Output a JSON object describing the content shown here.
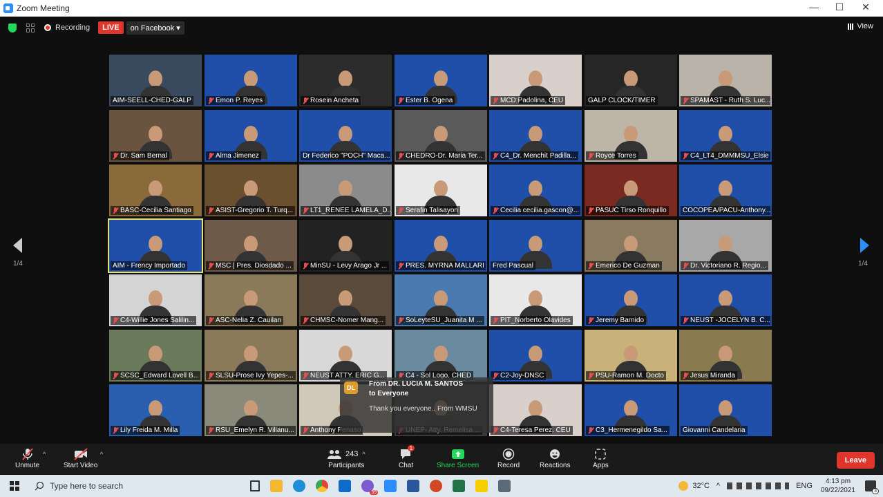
{
  "window": {
    "title": "Zoom Meeting",
    "minimize": "—",
    "maximize": "☐",
    "close": "✕"
  },
  "topbar": {
    "recording": "Recording",
    "live": "LIVE",
    "live_target": "on Facebook ▾",
    "view": "View"
  },
  "pagination": {
    "left": "1/4",
    "right": "1/4"
  },
  "participants": [
    {
      "name": "AIM-SEELL-CHED-GALP",
      "muted": false,
      "bg": "#3a4a5e"
    },
    {
      "name": "Emon P. Reyes",
      "muted": true,
      "bg": "#1f4fa8"
    },
    {
      "name": "Rosein Ancheta",
      "muted": true,
      "bg": "#2b2b2b"
    },
    {
      "name": "Ester B. Ogena",
      "muted": true,
      "bg": "#1f4fa8"
    },
    {
      "name": "MCD Padolina, CEU",
      "muted": true,
      "bg": "#d9d0cc"
    },
    {
      "name": "GALP CLOCK/TIMER",
      "muted": false,
      "bg": "#262626"
    },
    {
      "name": "SPAMAST - Ruth S. Luc...",
      "muted": true,
      "bg": "#b9b3aa"
    },
    {
      "name": "Dr. Sam Bernal",
      "muted": true,
      "bg": "#6a5440"
    },
    {
      "name": "Alma Jimenez",
      "muted": true,
      "bg": "#1f4fa8"
    },
    {
      "name": "Dr Federico \"POCH\" Maca...",
      "muted": false,
      "bg": "#1f4fa8"
    },
    {
      "name": "CHEDRO-Dr. Maria Ter...",
      "muted": true,
      "bg": "#5a5a5a"
    },
    {
      "name": "C4_Dr. Menchit Padilla...",
      "muted": true,
      "bg": "#1f4fa8"
    },
    {
      "name": "Royce Torres",
      "muted": true,
      "bg": "#bdb6a8"
    },
    {
      "name": "C4_LT4_DMMMSU_Elsie",
      "muted": true,
      "bg": "#1f4fa8"
    },
    {
      "name": "BASC-Cecilia Santiago",
      "muted": true,
      "bg": "#8a6a3a"
    },
    {
      "name": "ASIST-Gregorio T. Turq...",
      "muted": true,
      "bg": "#6b5030"
    },
    {
      "name": "LT1_RENEE LAMELA_D...",
      "muted": true,
      "bg": "#8b8b8b"
    },
    {
      "name": "Serafin Talisayon",
      "muted": true,
      "bg": "#e8e8e8"
    },
    {
      "name": "Cecilia cecilia.gascon@...",
      "muted": true,
      "bg": "#1f4fa8"
    },
    {
      "name": "PASUC Tirso Ronquillo",
      "muted": true,
      "bg": "#7a2a20"
    },
    {
      "name": "COCOPEA/PACU-Anthony...",
      "muted": false,
      "bg": "#1f4fa8"
    },
    {
      "name": "AIM - Frency Importado",
      "muted": false,
      "bg": "#1f4fa8",
      "active": true
    },
    {
      "name": "MSC | Pres. Diosdado ...",
      "muted": true,
      "bg": "#6e5a48"
    },
    {
      "name": "MinSU - Levy Arago Jr ...",
      "muted": true,
      "bg": "#222222"
    },
    {
      "name": "PRES. MYRNA MALLARI",
      "muted": true,
      "bg": "#1f4fa8"
    },
    {
      "name": "Fred Pascual",
      "muted": false,
      "bg": "#1f4fa8"
    },
    {
      "name": "Emerico De Guzman",
      "muted": true,
      "bg": "#8a7a60"
    },
    {
      "name": "Dr. Victoriano R. Regio...",
      "muted": true,
      "bg": "#a8a8a8"
    },
    {
      "name": "C4-Willie Jones Salilin...",
      "muted": true,
      "bg": "#d4d4d4"
    },
    {
      "name": "ASC-Nelia Z. Cauilan",
      "muted": true,
      "bg": "#8a7a5a"
    },
    {
      "name": "CHMSC-Nomer Mang...",
      "muted": true,
      "bg": "#5a4a3a"
    },
    {
      "name": "SoLeyteSU_Juanita M ...",
      "muted": true,
      "bg": "#4a7ab0"
    },
    {
      "name": "PIT_Norberto Olavides",
      "muted": true,
      "bg": "#e8e8e8"
    },
    {
      "name": "Jeremy Barnido",
      "muted": true,
      "bg": "#1f4fa8"
    },
    {
      "name": "NEUST -JOCELYN B. C...",
      "muted": true,
      "bg": "#1f4fa8"
    },
    {
      "name": "SCSC_Edward Lovell B...",
      "muted": true,
      "bg": "#6a7a5a"
    },
    {
      "name": "SLSU-Prose Ivy Yepes-...",
      "muted": true,
      "bg": "#8a7a5a"
    },
    {
      "name": "NEUST ATTY. ERIC G...",
      "muted": true,
      "bg": "#d8d8d8"
    },
    {
      "name": "C4 - Sol Logo, CHED",
      "muted": true,
      "bg": "#6a8aa0"
    },
    {
      "name": "C2-Joy-DNSC",
      "muted": true,
      "bg": "#1f4fa8"
    },
    {
      "name": "PSU-Ramon M. Docto",
      "muted": true,
      "bg": "#c9b27a"
    },
    {
      "name": "Jesus Miranda",
      "muted": true,
      "bg": "#8a7a50"
    },
    {
      "name": "Lily Freida M. Milla",
      "muted": true,
      "bg": "#2a5fb0"
    },
    {
      "name": "RSU_Emelyn R. Villanu...",
      "muted": true,
      "bg": "#8a8a7a"
    },
    {
      "name": "Anthony Penaso",
      "muted": true,
      "bg": "#d0c8b8"
    },
    {
      "name": "UNEP- Atty. Remelisa ...",
      "muted": true,
      "bg": "#3a3a3a"
    },
    {
      "name": "C4-Teresa Perez. CEU",
      "muted": true,
      "bg": "#d9d0cc"
    },
    {
      "name": "C3_Hermenegildo Sa...",
      "muted": true,
      "bg": "#1f4fa8"
    },
    {
      "name": "Giovanni Candelaria",
      "muted": false,
      "bg": "#1f4fa8"
    }
  ],
  "chat_popup": {
    "avatar": "DL",
    "from": "From DR. LUCIA M. SANTOS",
    "to": "to Everyone",
    "message": "Thank you everyone.. From WMSU"
  },
  "controls": {
    "unmute": "Unmute",
    "start_video": "Start Video",
    "participants_count": "243",
    "participants": "Participants",
    "chat": "Chat",
    "chat_badge": "1",
    "share": "Share Screen",
    "record": "Record",
    "reactions": "Reactions",
    "apps": "Apps",
    "leave": "Leave"
  },
  "taskbar": {
    "search_placeholder": "Type here to search",
    "badge": "39",
    "temperature": "32°C",
    "lang": "ENG",
    "time": "4:13 pm",
    "date": "09/22/2021",
    "notif": "3"
  }
}
